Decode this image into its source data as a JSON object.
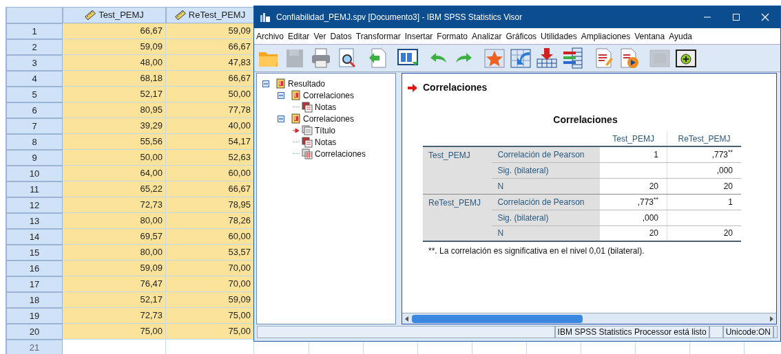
{
  "data_grid": {
    "columns": [
      "Test_PEMJ",
      "ReTest_PEMJ"
    ],
    "rows": [
      {
        "number": "1",
        "values": [
          "66,67",
          "59,09"
        ]
      },
      {
        "number": "2",
        "values": [
          "59,09",
          "66,67"
        ]
      },
      {
        "number": "3",
        "values": [
          "48,00",
          "47,83"
        ]
      },
      {
        "number": "4",
        "values": [
          "68,18",
          "66,67"
        ]
      },
      {
        "number": "5",
        "values": [
          "52,17",
          "50,00"
        ]
      },
      {
        "number": "6",
        "values": [
          "80,95",
          "77,78"
        ]
      },
      {
        "number": "7",
        "values": [
          "39,29",
          "40,00"
        ]
      },
      {
        "number": "8",
        "values": [
          "55,56",
          "54,17"
        ]
      },
      {
        "number": "9",
        "values": [
          "50,00",
          "52,63"
        ]
      },
      {
        "number": "10",
        "values": [
          "64,00",
          "60,00"
        ]
      },
      {
        "number": "11",
        "values": [
          "65,22",
          "66,67"
        ]
      },
      {
        "number": "12",
        "values": [
          "72,73",
          "78,95"
        ]
      },
      {
        "number": "13",
        "values": [
          "80,00",
          "78,26"
        ]
      },
      {
        "number": "14",
        "values": [
          "69,57",
          "60,00"
        ]
      },
      {
        "number": "15",
        "values": [
          "80,00",
          "53,57"
        ]
      },
      {
        "number": "16",
        "values": [
          "59,09",
          "70,00"
        ]
      },
      {
        "number": "17",
        "values": [
          "76,47",
          "70,00"
        ]
      },
      {
        "number": "18",
        "values": [
          "52,17",
          "59,09"
        ]
      },
      {
        "number": "19",
        "values": [
          "72,73",
          "75,00"
        ]
      },
      {
        "number": "20",
        "values": [
          "75,00",
          "75,00"
        ]
      },
      {
        "number": "21",
        "values": []
      }
    ]
  },
  "window": {
    "title": "Confiabilidad_PEMJ.spv [Documento3] - IBM SPSS Statistics Visor",
    "menu": [
      "Archivo",
      "Editar",
      "Ver",
      "Datos",
      "Transformar",
      "Insertar",
      "Formato",
      "Analizar",
      "Gráficos",
      "Utilidades",
      "Ampliaciones",
      "Ventana",
      "Ayuda"
    ],
    "toolbar": [
      {
        "kind": "open",
        "disabled": false
      },
      {
        "kind": "save",
        "disabled": true
      },
      {
        "kind": "print",
        "disabled": false
      },
      {
        "kind": "preview",
        "disabled": false
      },
      {
        "kind": "export",
        "disabled": false
      },
      {
        "kind": "dialog",
        "disabled": false
      },
      {
        "kind": "undo",
        "disabled": false
      },
      {
        "kind": "redo",
        "disabled": false
      },
      {
        "kind": "star",
        "disabled": false
      },
      {
        "kind": "goto",
        "disabled": false
      },
      {
        "kind": "insert",
        "disabled": false
      },
      {
        "kind": "variables",
        "disabled": false
      },
      {
        "kind": "edit",
        "disabled": false
      },
      {
        "kind": "play",
        "disabled": false
      },
      {
        "kind": "blank",
        "disabled": true
      },
      {
        "kind": "add",
        "disabled": false
      }
    ],
    "outline": [
      {
        "label": "Resultado",
        "kind": "folder",
        "expanded": true,
        "children": [
          {
            "label": "Correlaciones",
            "kind": "folder",
            "expanded": true,
            "children": [
              {
                "label": "Notas",
                "kind": "notes",
                "current": false
              }
            ]
          },
          {
            "label": "Correlaciones",
            "kind": "folder",
            "expanded": true,
            "children": [
              {
                "label": "Título",
                "kind": "title",
                "current": true
              },
              {
                "label": "Notas",
                "kind": "notes",
                "current": false
              },
              {
                "label": "Correlaciones",
                "kind": "table",
                "current": false
              }
            ]
          }
        ]
      }
    ],
    "output": {
      "heading": "Correlaciones",
      "table": {
        "title": "Correlaciones",
        "columns": [
          "Test_PEMJ",
          "ReTest_PEMJ"
        ],
        "groups": [
          {
            "label": "Test_PEMJ",
            "rows": [
              {
                "label": "Correlación de Pearson",
                "test_pemj": "1",
                "retest_pemj": ",773$^{**}$"
              },
              {
                "label": "Sig. (bilateral)",
                "retest_pemj": ",000"
              },
              {
                "label": "N",
                "test_pemj": "20",
                "retest_pemj": "20"
              }
            ]
          },
          {
            "label": "ReTest_PEMJ",
            "rows": [
              {
                "label": "Correlación de Pearson",
                "test_pemj": ",773$^{**}$",
                "retest_pemj": "1"
              },
              {
                "label": "Sig. (bilateral)",
                "test_pemj": ",000"
              },
              {
                "label": "N",
                "test_pemj": "20",
                "retest_pemj": "20"
              }
            ]
          }
        ],
        "footnote": "**. La correlación es significativa en el nivel 0,01 (bilateral)."
      }
    },
    "status_bar": [
      {
        "kind": "text",
        "text": "IBM SPSS Statistics Processor está listo"
      },
      {
        "kind": "empty"
      },
      {
        "kind": "text",
        "text": "Unicode:ON"
      }
    ]
  }
}
